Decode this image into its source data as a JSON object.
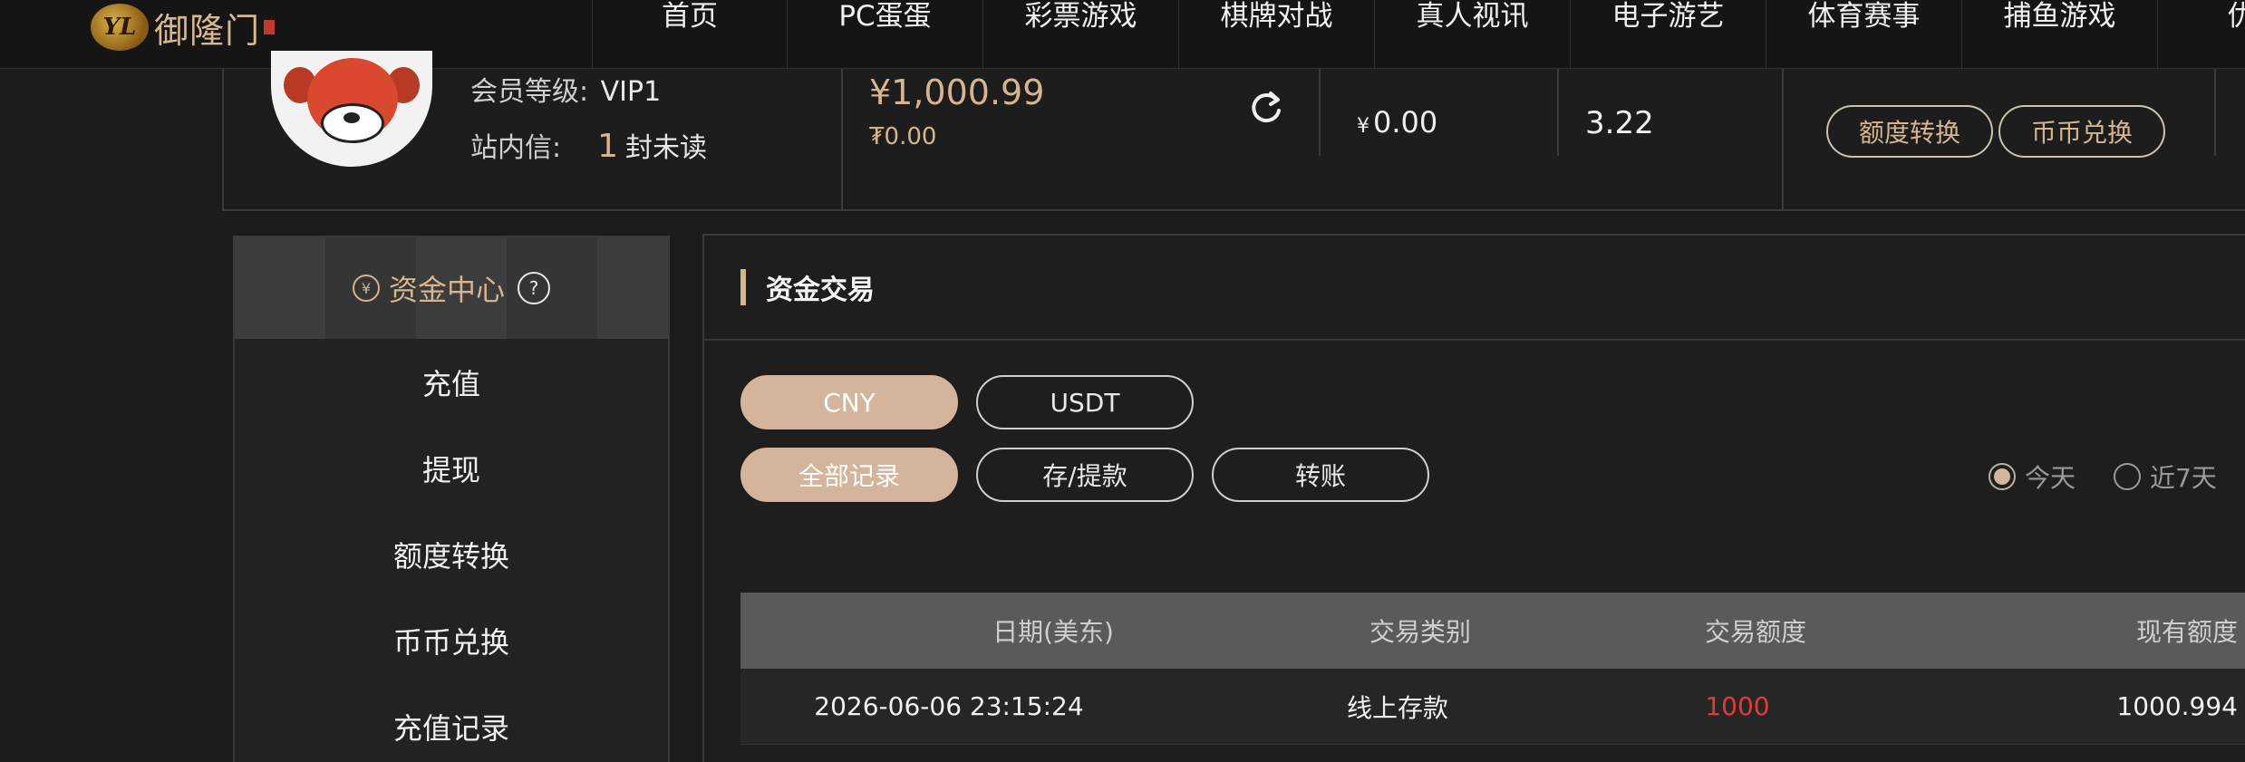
{
  "nav": {
    "logo_text": "御隆门",
    "items": [
      "首页",
      "PC蛋蛋",
      "彩票游戏",
      "棋牌对战",
      "真人视讯",
      "电子游艺",
      "体育赛事",
      "捕鱼游戏",
      "优惠"
    ]
  },
  "account": {
    "vip_label": "会员等级:",
    "vip_value": "VIP1",
    "msg_label": "站内信:",
    "msg_count": "1",
    "msg_suffix": "封未读",
    "main_balance": "¥1,000.99",
    "sub_balance": "₮0.00",
    "balance_a_currency": "¥",
    "balance_a": "0.00",
    "balance_b": "3.22",
    "transfer_button": "额度转换",
    "exchange_button": "币币兑换"
  },
  "sidebar": {
    "title": "资金中心",
    "items": [
      "充值",
      "提现",
      "额度转换",
      "币币兑换",
      "充值记录"
    ]
  },
  "main": {
    "title": "资金交易",
    "currency_tabs": [
      "CNY",
      "USDT"
    ],
    "currency_selected": "CNY",
    "type_tabs": [
      "全部记录",
      "存/提款",
      "转账"
    ],
    "type_selected": "全部记录",
    "range_options": [
      "今天",
      "近7天"
    ],
    "range_selected": "今天",
    "table": {
      "columns": [
        "日期(美东)",
        "交易类别",
        "交易额度",
        "现有额度"
      ],
      "rows": [
        {
          "date": "2026-06-06 23:15:24",
          "type": "线上存款",
          "amount": "1000",
          "balance": "1000.994"
        }
      ]
    }
  },
  "colors": {
    "accent": "#d6b48e",
    "active_tab": "#d4b49a",
    "amount_red": "#e53935"
  }
}
